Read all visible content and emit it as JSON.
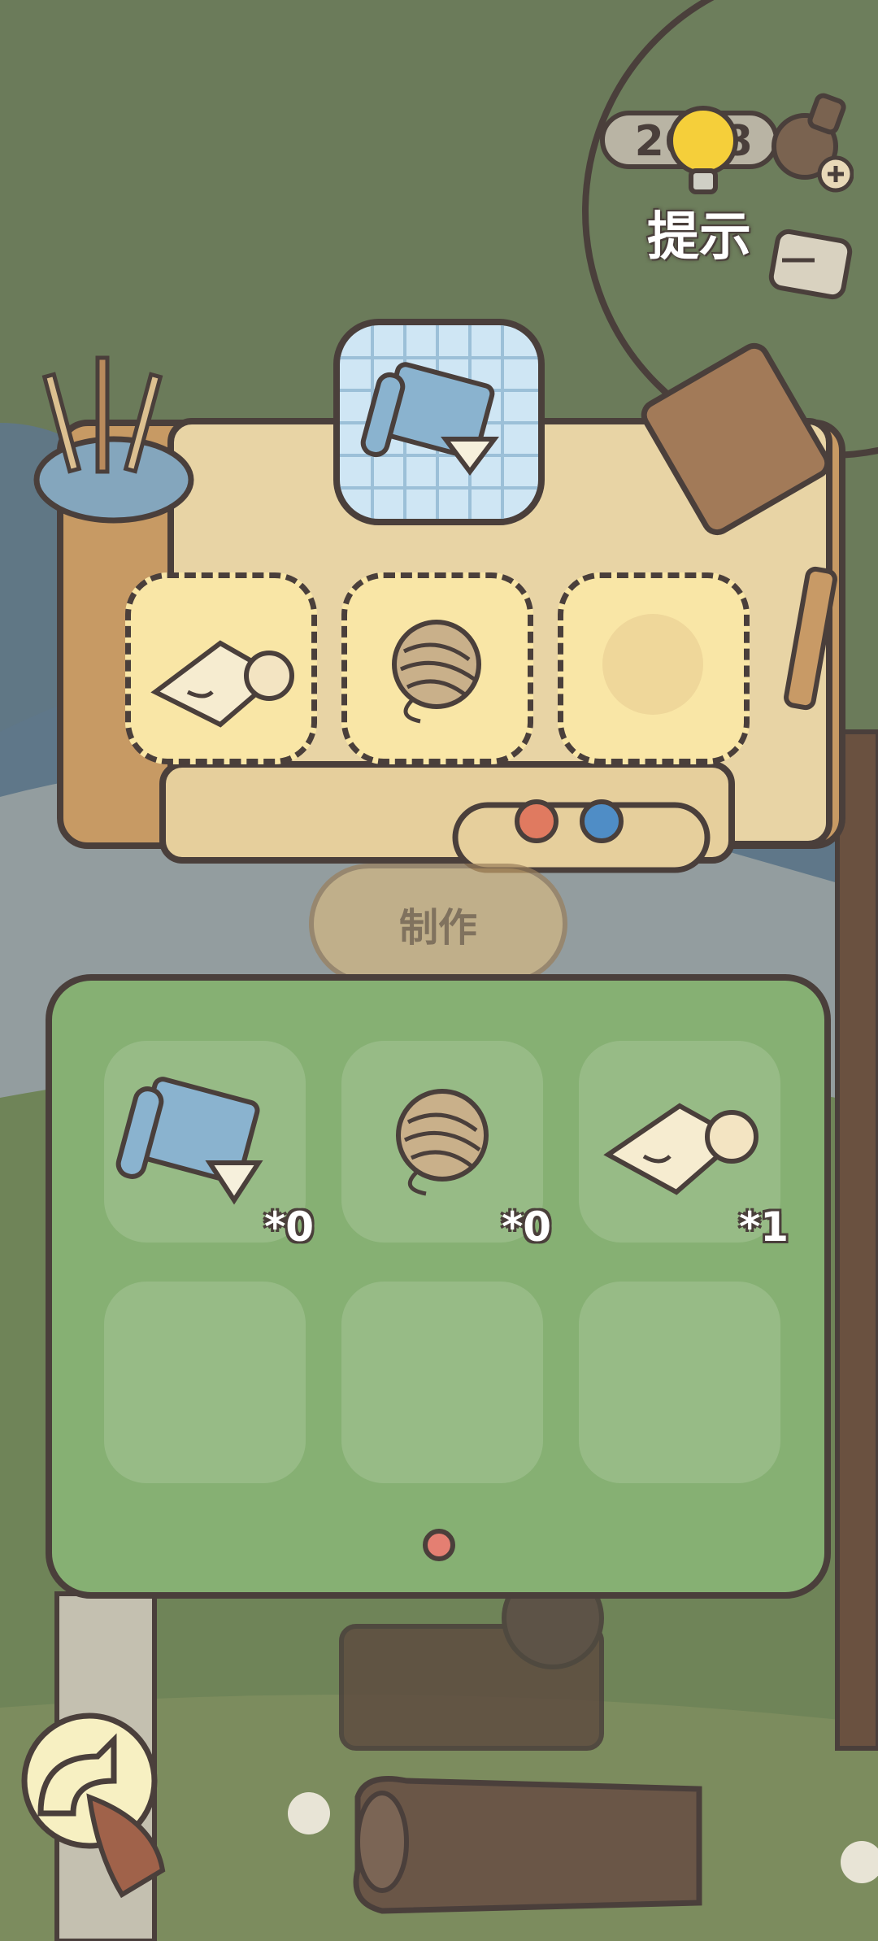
{
  "hud": {
    "hint_count": "2608",
    "hint_label": "提示"
  },
  "craft": {
    "button_label": "制作",
    "recipe_slots": [
      "paper",
      "yarn",
      "empty"
    ],
    "target_item": "blueprint"
  },
  "inventory": {
    "items": [
      {
        "name": "blueprint",
        "count": "*0"
      },
      {
        "name": "yarn-ball",
        "count": "*0"
      },
      {
        "name": "paper-scroll",
        "count": "*1"
      }
    ],
    "empty_slots": 3,
    "page": 1
  },
  "colors": {
    "outline": "#4a3f3b",
    "panel": "#86b073",
    "table": "#e8d4a5",
    "slot_yellow": "#f9e6a6",
    "target_blue": "#cfe6f4",
    "dot": "#e47f72"
  }
}
